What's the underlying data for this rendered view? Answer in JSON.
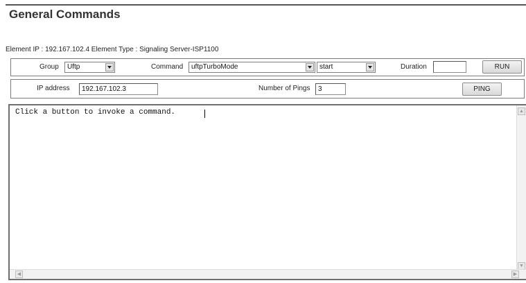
{
  "page": {
    "title": "General Commands"
  },
  "element_info": {
    "text": "Element IP : 192.167.102.4    Element Type : Signaling Server-ISP1100"
  },
  "command_row": {
    "group_label": "Group",
    "group_value": "Uftp",
    "command_label": "Command",
    "command_value": "uftpTurboMode",
    "action_value": "start",
    "duration_label": "Duration",
    "duration_value": "",
    "run_label": "RUN"
  },
  "ping_row": {
    "ip_label": "IP address",
    "ip_value": "192.167.102.3",
    "pings_label": "Number of Pings",
    "pings_value": "3",
    "ping_label": "PING"
  },
  "output": {
    "text": "Click a button to invoke a command."
  },
  "icons": {
    "dropdown": "chevron-down-icon",
    "scroll_up": "arrow-up-icon",
    "scroll_down": "arrow-down-icon",
    "scroll_left": "arrow-left-icon",
    "scroll_right": "arrow-right-icon"
  }
}
